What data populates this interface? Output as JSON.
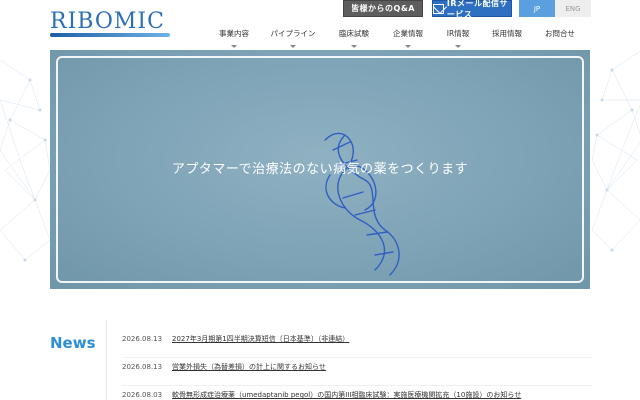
{
  "header": {
    "logo_text": "RIBOMIC",
    "qa_button_label": "皆様からのQ&A",
    "ir_button_label": "IRメール配信サービス",
    "lang_jp_label": "JP",
    "lang_en_label": "ENG",
    "accent_color": "#2e8ed6",
    "nav": [
      {
        "label": "事業内容",
        "has_dropdown": true
      },
      {
        "label": "パイプライン",
        "has_dropdown": true
      },
      {
        "label": "臨床試験",
        "has_dropdown": true
      },
      {
        "label": "企業情報",
        "has_dropdown": true
      },
      {
        "label": "IR情報",
        "has_dropdown": true
      },
      {
        "label": "採用情報",
        "has_dropdown": false
      },
      {
        "label": "お問合せ",
        "has_dropdown": false
      }
    ]
  },
  "hero": {
    "title": "アプタマーで治療法のない病気の薬をつくります"
  },
  "news": {
    "heading": "News",
    "items": [
      {
        "date": "2026.08.13",
        "title": "2027年3月期第1四半期決算短信〔日本基準〕（非連結）"
      },
      {
        "date": "2026.08.13",
        "title": "営業外損失（為替差損）の計上に関するお知らせ"
      },
      {
        "date": "2026.08.03",
        "title": "軟骨無形成症治療薬（umedaptanib pegol）の国内第III相臨床試験：実施医療機関拡充（10施設）のお知らせ"
      }
    ]
  }
}
